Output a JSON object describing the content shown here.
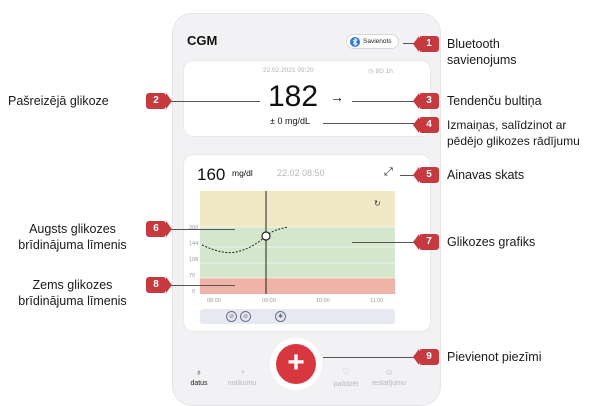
{
  "app": {
    "title": "CGM",
    "bluetooth_label": "Savienots"
  },
  "current_card": {
    "date_time": "22.02.2021 09:20",
    "sensor_days": "8D 1h",
    "glucose_value": "182",
    "trend_arrow": "→",
    "change": "± 0 mg/dL"
  },
  "graph_card": {
    "value": "160",
    "unit": "mg/dl",
    "timestamp": "22.02 08:50",
    "y_ticks": [
      "200",
      "144",
      "108",
      "70",
      "0"
    ],
    "x_ticks": [
      "08:00",
      "09:00",
      "10:00",
      "11:00"
    ]
  },
  "nav": {
    "items": [
      {
        "label": "datus",
        "active": true
      },
      {
        "label": "notikumu",
        "active": false
      },
      {
        "label": "palīdzēt",
        "active": false
      },
      {
        "label": "iestatījumu",
        "active": false
      }
    ]
  },
  "callouts": [
    {
      "num": "1",
      "text": "Bluetooth\nsavienojums"
    },
    {
      "num": "2",
      "text": "Pašreizējā glikoze"
    },
    {
      "num": "3",
      "text": "Tendenču bultiņa"
    },
    {
      "num": "4",
      "text": "Izmaiņas, salīdzinot ar\npēdējo glikozes rādījumu"
    },
    {
      "num": "5",
      "text": "Ainavas skats"
    },
    {
      "num": "6",
      "text": "Augsts glikozes\nbrīdinājuma līmenis"
    },
    {
      "num": "7",
      "text": "Glikozes grafiks"
    },
    {
      "num": "8",
      "text": "Zems glikozes\nbrīdinājuma līmenis"
    },
    {
      "num": "9",
      "text": "Pievienot piezīmi"
    }
  ],
  "colors": {
    "accent_red": "#c63a3f",
    "fab_red": "#d8373f",
    "bluetooth_blue": "#2b79d6",
    "zone_high": "#f1e8c6",
    "zone_target": "#d4e7cd",
    "zone_low": "#efb3a8"
  },
  "icons": [
    "bluetooth-icon",
    "trend-arrow-icon",
    "expand-icon",
    "refresh-icon",
    "drop-icon",
    "chart-icon",
    "heart-icon",
    "smile-icon",
    "plus-icon"
  ]
}
